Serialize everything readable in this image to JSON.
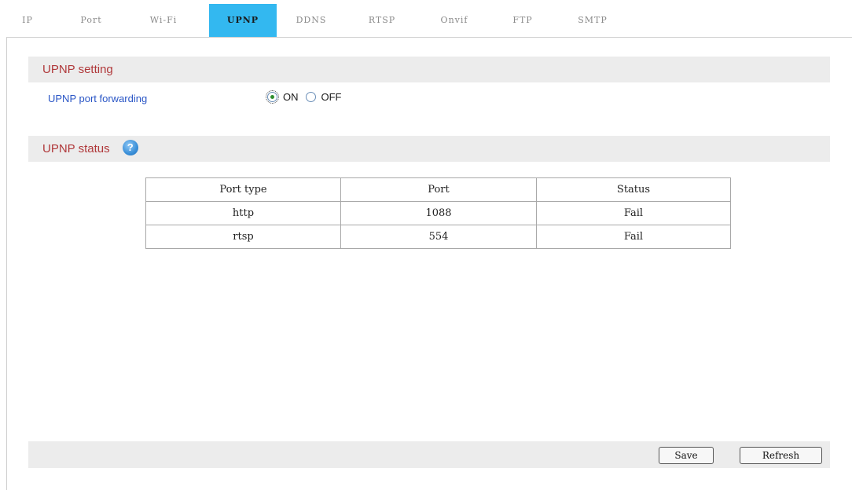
{
  "tabs": [
    {
      "label": "IP",
      "active": false
    },
    {
      "label": "Port",
      "active": false
    },
    {
      "label": "Wi-Fi",
      "active": false
    },
    {
      "label": "UPNP",
      "active": true
    },
    {
      "label": "DDNS",
      "active": false
    },
    {
      "label": "RTSP",
      "active": false
    },
    {
      "label": "Onvif",
      "active": false
    },
    {
      "label": "FTP",
      "active": false
    },
    {
      "label": "SMTP",
      "active": false
    }
  ],
  "setting": {
    "header": "UPNP setting",
    "field_label": "UPNP port forwarding",
    "on_label": "ON",
    "off_label": "OFF",
    "selected": "ON"
  },
  "status": {
    "header": "UPNP status",
    "help_icon": "help-icon",
    "help_glyph": "?",
    "columns": [
      "Port type",
      "Port",
      "Status"
    ],
    "rows": [
      [
        "http",
        "1088",
        "Fail"
      ],
      [
        "rtsp",
        "554",
        "Fail"
      ]
    ]
  },
  "buttons": {
    "save": "Save",
    "refresh": "Refresh"
  },
  "colors": {
    "active_tab": "#33b8f0",
    "section_title": "#b0383a",
    "field_label": "#2a56c6",
    "section_bg": "#ececec"
  }
}
